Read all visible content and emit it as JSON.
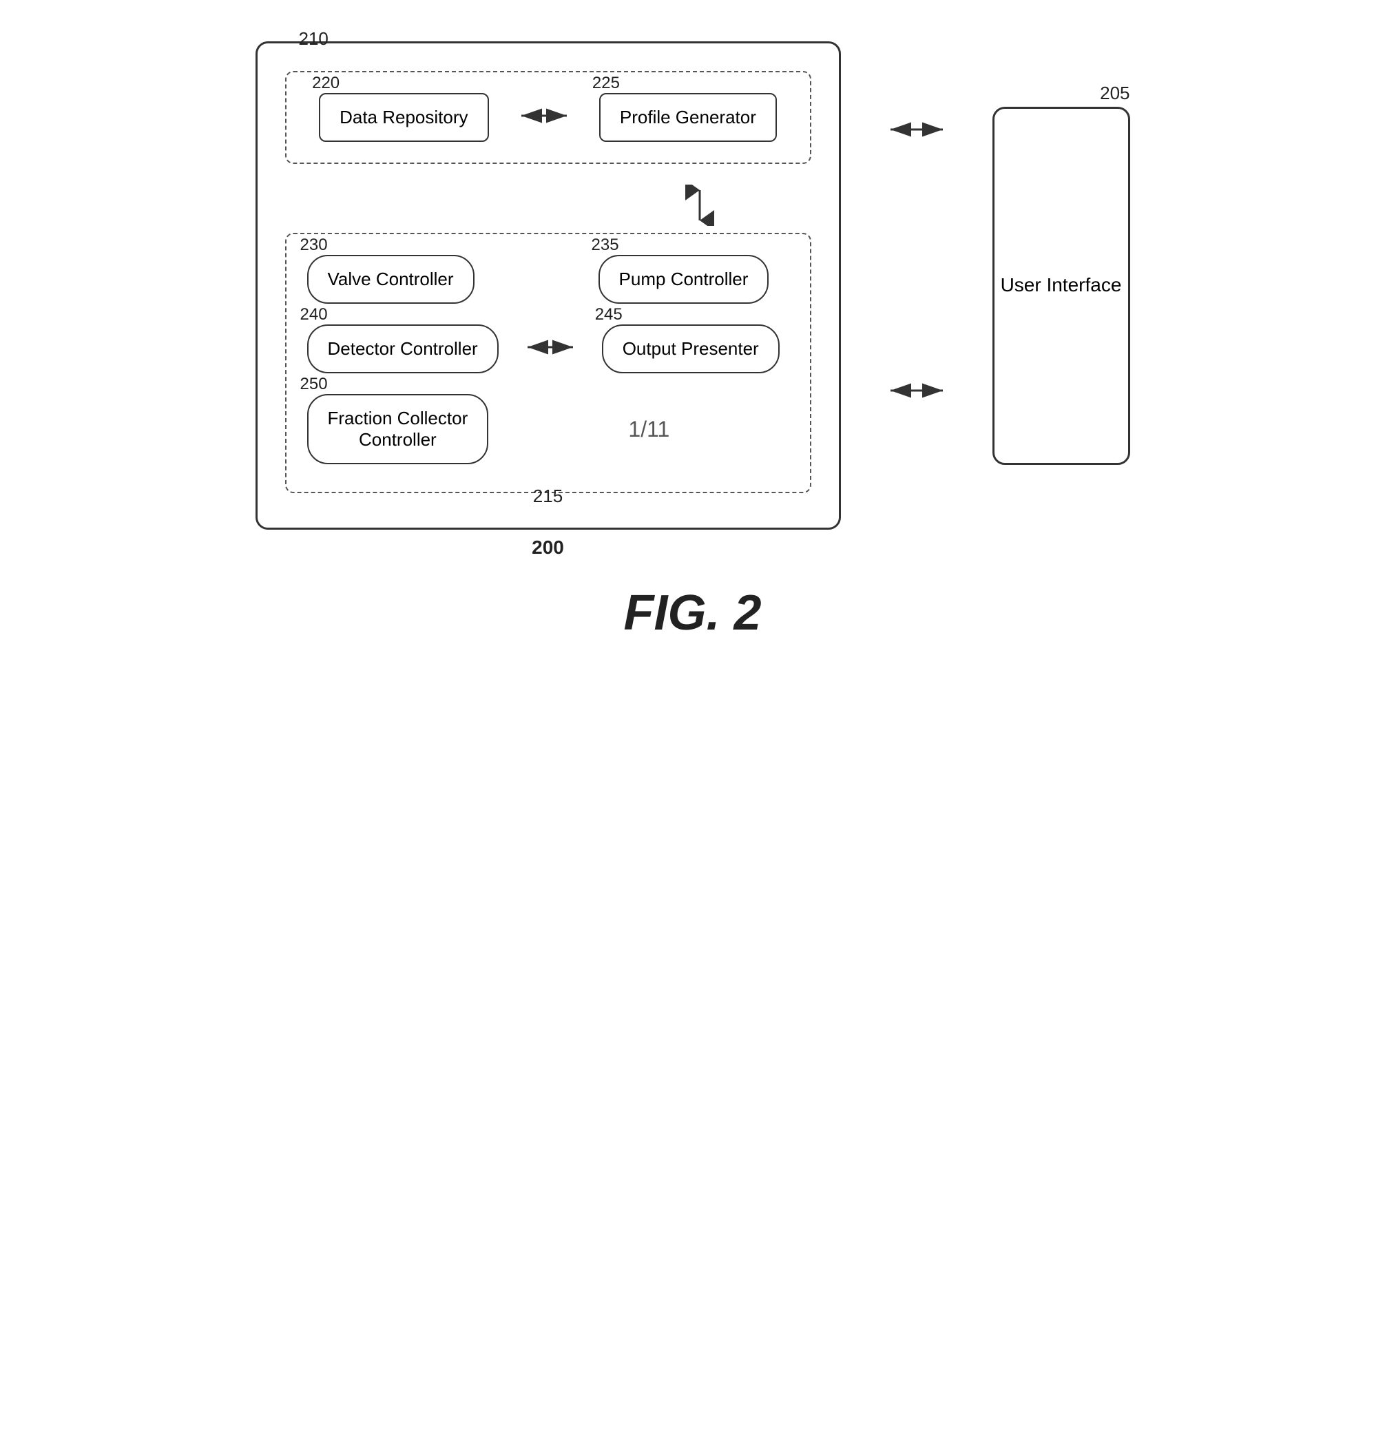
{
  "diagram": {
    "title": "FIG. 2",
    "ref200": "200",
    "ref205": "205",
    "ref210": "210",
    "ref215": "215",
    "ref220": "220",
    "ref225": "225",
    "ref230": "230",
    "ref235": "235",
    "ref240": "240",
    "ref245": "245",
    "ref250": "250",
    "boxes": {
      "dataRepository": "Data Repository",
      "profileGenerator": "Profile Generator",
      "valveController": "Valve Controller",
      "pumpController": "Pump Controller",
      "detectorController": "Detector Controller",
      "outputPresenter": "Output Presenter",
      "fractionCollectorController": "Fraction Collector\nController",
      "userInterface": "User Interface"
    },
    "pageLabel": "1/11"
  }
}
